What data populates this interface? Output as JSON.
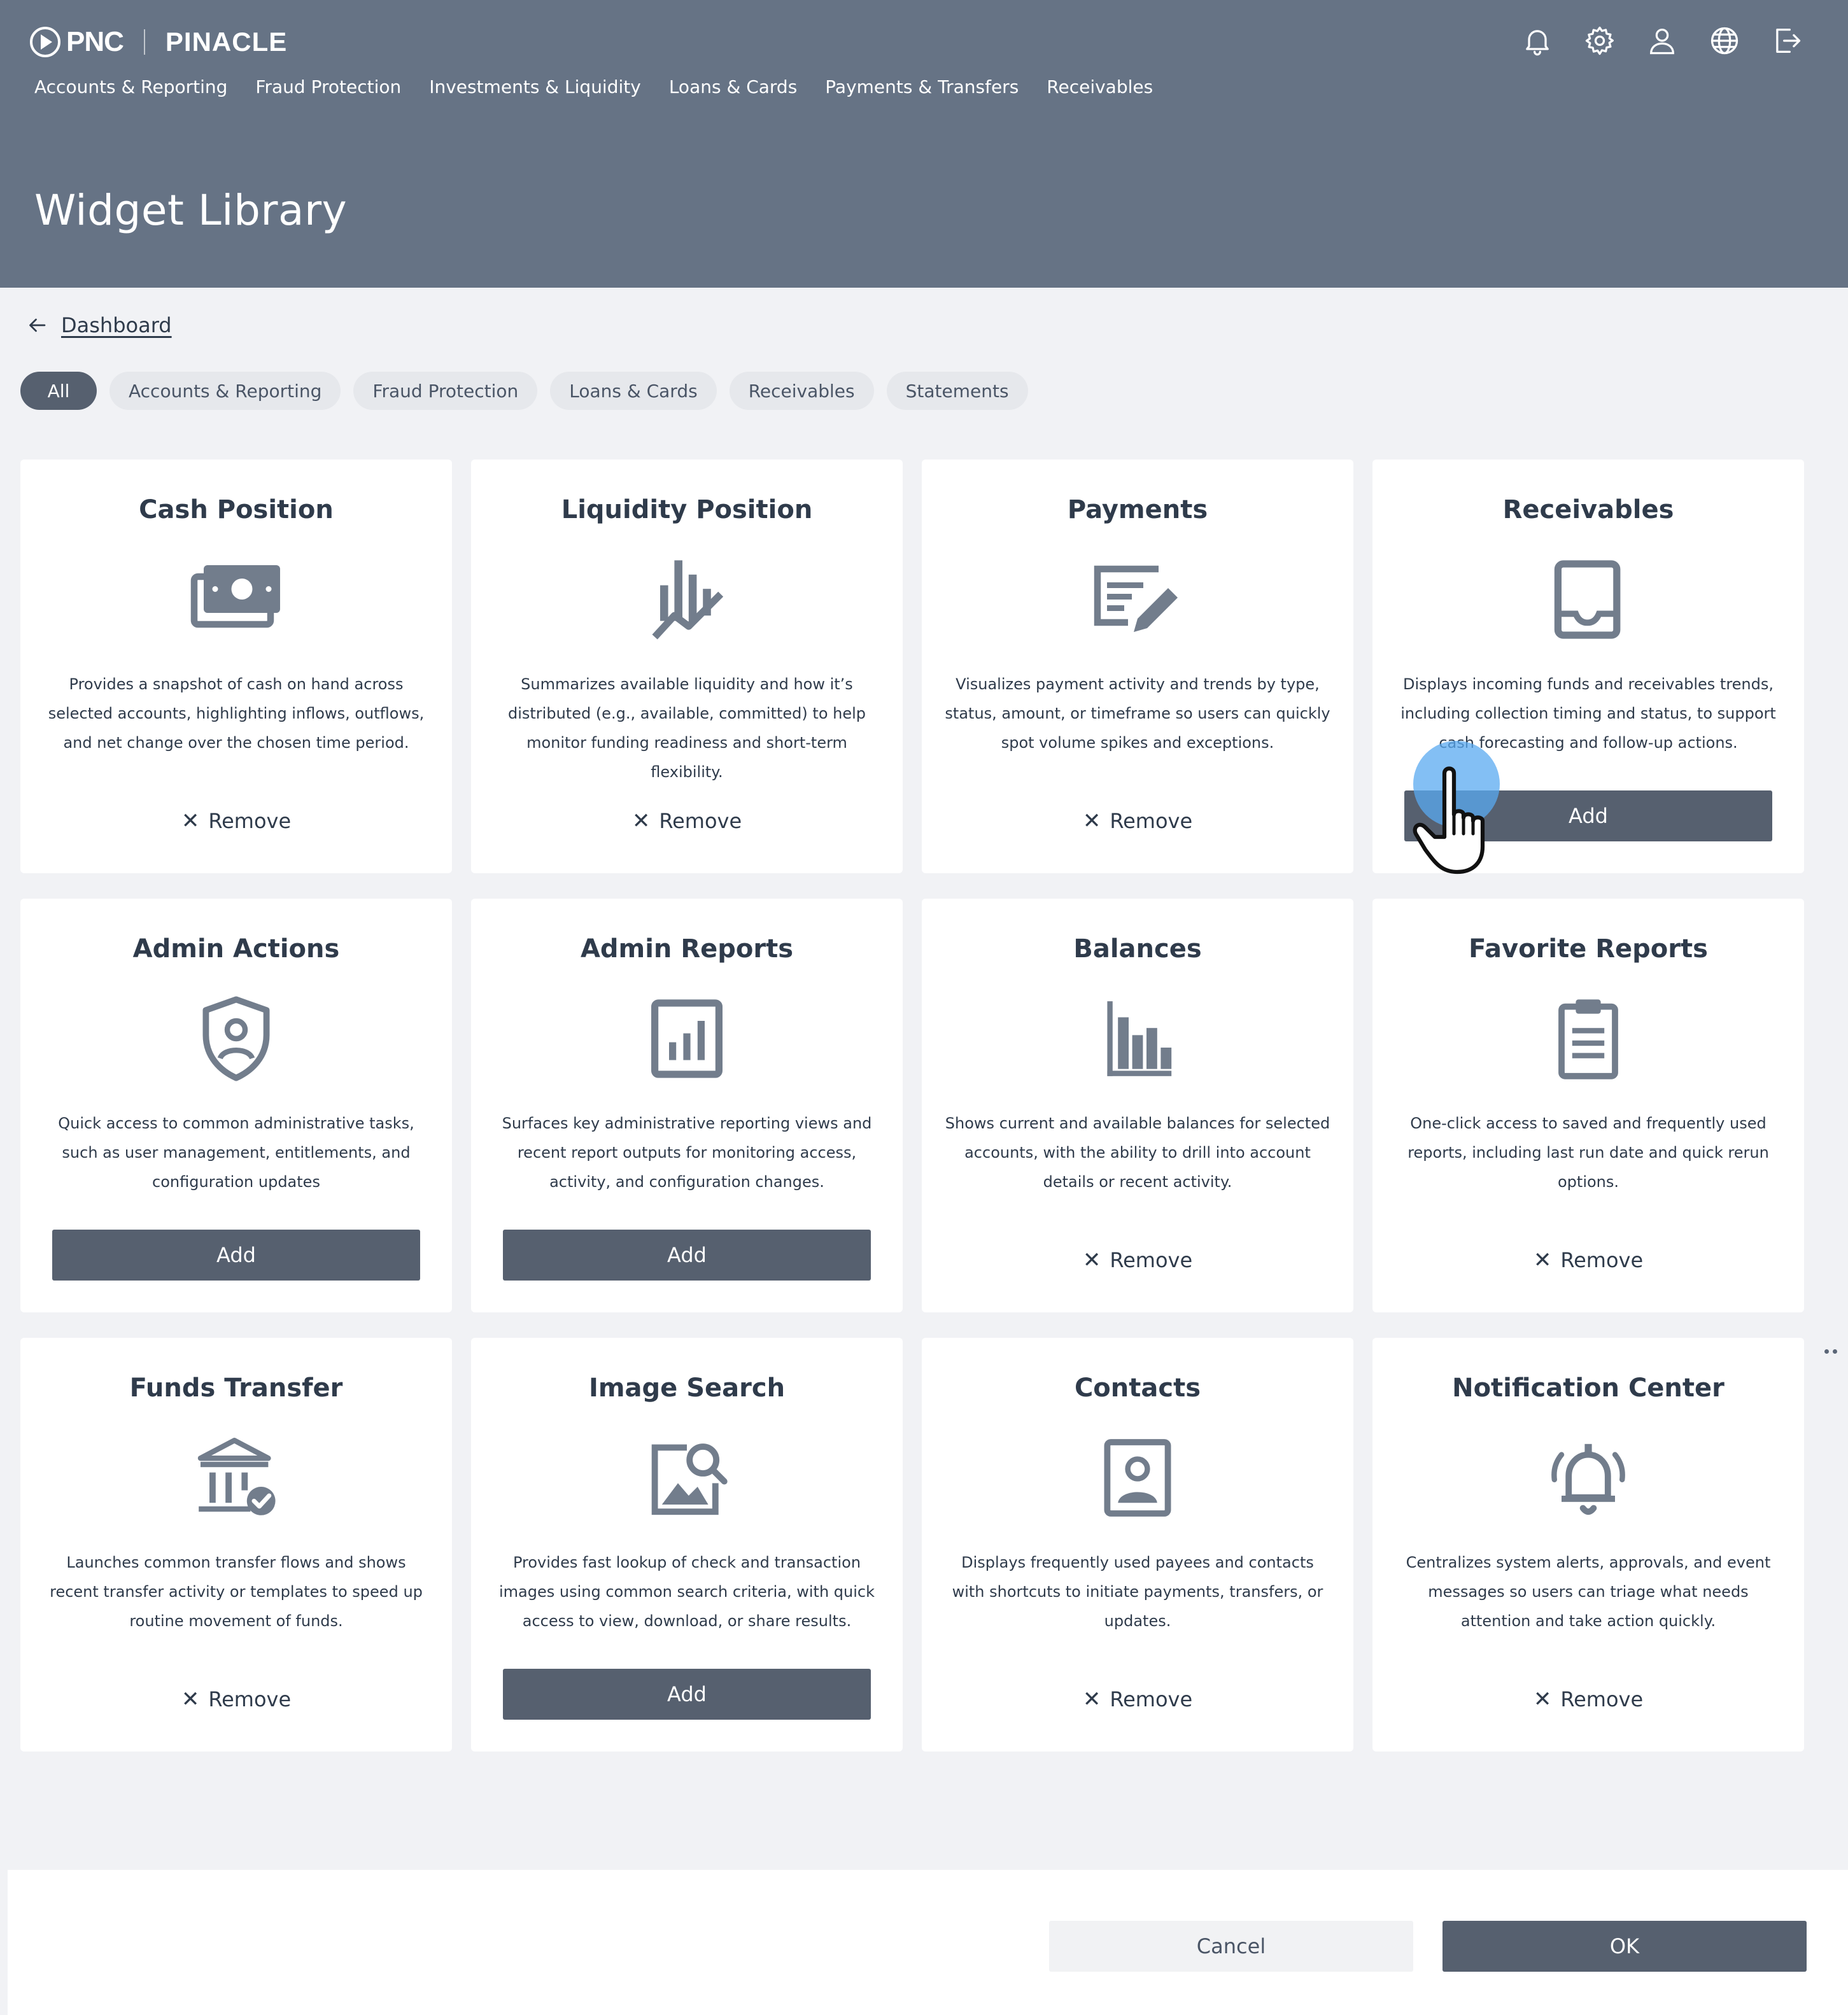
{
  "brand": {
    "logo_text": "PNC",
    "product_name": "PINACLE"
  },
  "header_icons": [
    "bell-icon",
    "gear-icon",
    "user-icon",
    "globe-icon",
    "logout-icon"
  ],
  "main_nav": [
    {
      "label": "Accounts & Reporting"
    },
    {
      "label": "Fraud Protection"
    },
    {
      "label": "Investments & Liquidity"
    },
    {
      "label": "Loans & Cards"
    },
    {
      "label": "Payments & Transfers"
    },
    {
      "label": "Receivables"
    }
  ],
  "page": {
    "title": "Widget Library"
  },
  "breadcrumb": {
    "back_label": "Dashboard"
  },
  "filters": [
    {
      "label": "All",
      "active": true
    },
    {
      "label": "Accounts & Reporting",
      "active": false
    },
    {
      "label": "Fraud Protection",
      "active": false
    },
    {
      "label": "Loans & Cards",
      "active": false
    },
    {
      "label": "Receivables",
      "active": false
    },
    {
      "label": "Statements",
      "active": false
    }
  ],
  "actions": {
    "remove_label": "Remove",
    "add_label": "Add"
  },
  "widgets": [
    {
      "title": "Cash Position",
      "icon": "cash-icon",
      "description": "Provides a snapshot of cash on hand across selected accounts, highlighting inflows, outflows, and net change over the chosen time period.",
      "state": "remove"
    },
    {
      "title": "Liquidity Position",
      "icon": "liquidity-chart-icon",
      "description": "Summarizes available liquidity and how it’s distributed (e.g., available, committed) to help monitor funding readiness and short-term flexibility.",
      "state": "remove"
    },
    {
      "title": "Payments",
      "icon": "payment-edit-icon",
      "description": "Visualizes payment activity and trends by type, status, amount, or timeframe so users can quickly spot volume spikes and exceptions.",
      "state": "remove"
    },
    {
      "title": "Receivables",
      "icon": "inbox-tray-icon",
      "description": "Displays incoming funds and receivables trends, including collection timing and status, to support cash forecasting and follow-up actions.",
      "state": "add"
    },
    {
      "title": "Admin Actions",
      "icon": "shield-user-icon",
      "description": "Quick access to common administrative tasks, such as user management, entitlements, and configuration updates",
      "state": "add"
    },
    {
      "title": "Admin Reports",
      "icon": "report-chart-icon",
      "description": "Surfaces key administrative reporting views and recent report outputs for monitoring access, activity, and configuration changes.",
      "state": "add"
    },
    {
      "title": "Balances",
      "icon": "bar-chart-icon",
      "description": "Shows current and available balances for selected accounts, with the ability to drill into account details or recent activity.",
      "state": "remove"
    },
    {
      "title": "Favorite Reports",
      "icon": "clipboard-icon",
      "description": "One-click access to saved and frequently used reports, including last run date and quick rerun options.",
      "state": "remove"
    },
    {
      "title": "Funds Transfer",
      "icon": "bank-check-icon",
      "description": "Launches common transfer flows and shows recent transfer activity or templates to speed up routine movement of funds.",
      "state": "remove"
    },
    {
      "title": "Image Search",
      "icon": "image-search-icon",
      "description": "Provides fast lookup of check and transaction images using common search criteria, with quick access to view, download, or share results.",
      "state": "add"
    },
    {
      "title": "Contacts",
      "icon": "contact-card-icon",
      "description": "Displays frequently used payees and contacts with shortcuts to initiate payments, transfers, or updates.",
      "state": "remove"
    },
    {
      "title": "Notification Center",
      "icon": "alarm-bell-icon",
      "description": "Centralizes system alerts, approvals, and event messages so users can triage what needs attention and take action quickly.",
      "state": "remove"
    }
  ],
  "footer": {
    "cancel_label": "Cancel",
    "ok_label": "OK"
  },
  "colors": {
    "header_bg": "#667385",
    "primary_button": "#56606f",
    "page_bg": "#f1f2f5",
    "icon_gray": "#727d8c",
    "cursor_halo": "#5aaaf0"
  }
}
